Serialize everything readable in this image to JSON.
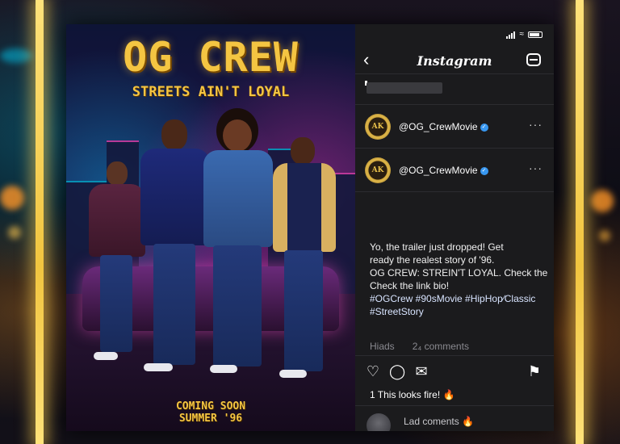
{
  "poster": {
    "title": "OG CREW",
    "tagline": "STREETS AIN'T LOYAL",
    "footer_line1": "COMING SOON",
    "footer_line2": "SUMMER '96"
  },
  "app": {
    "title": "Instagram",
    "back_icon": "chevron-left-icon",
    "camera_icon": "camera-icon"
  },
  "accounts": [
    {
      "handle": "@OG_CrewMovie",
      "avatar_text": "AK",
      "verified": true
    },
    {
      "handle": "@OG_CrewMovie",
      "avatar_text": "AK",
      "verified": true
    }
  ],
  "post": {
    "caption_lines": [
      "Yo, the trailer just dropped! Get",
      "ready the realest story of '96.",
      "OG CREW: STREIN'T LOYAL. Check the",
      "Check the link bio!"
    ],
    "hashtags_line1": "#OGCrew #90sMovie #HipHop∕Classic",
    "hashtags_line2": "#StreetStory",
    "meta_likes": "Hiads",
    "meta_comments": "2₄ comments",
    "likes_text": "1 This looks fire! 🔥",
    "comment_preview": "Lad coments 🔥"
  },
  "icons": {
    "like": "heart-icon",
    "comment": "comment-icon",
    "share": "share-icon",
    "save": "bookmark-icon",
    "more": "more-icon"
  },
  "colors": {
    "accent_gold": "#f4c542",
    "verified_blue": "#3897f0",
    "panel_bg": "#1b1b1d"
  }
}
